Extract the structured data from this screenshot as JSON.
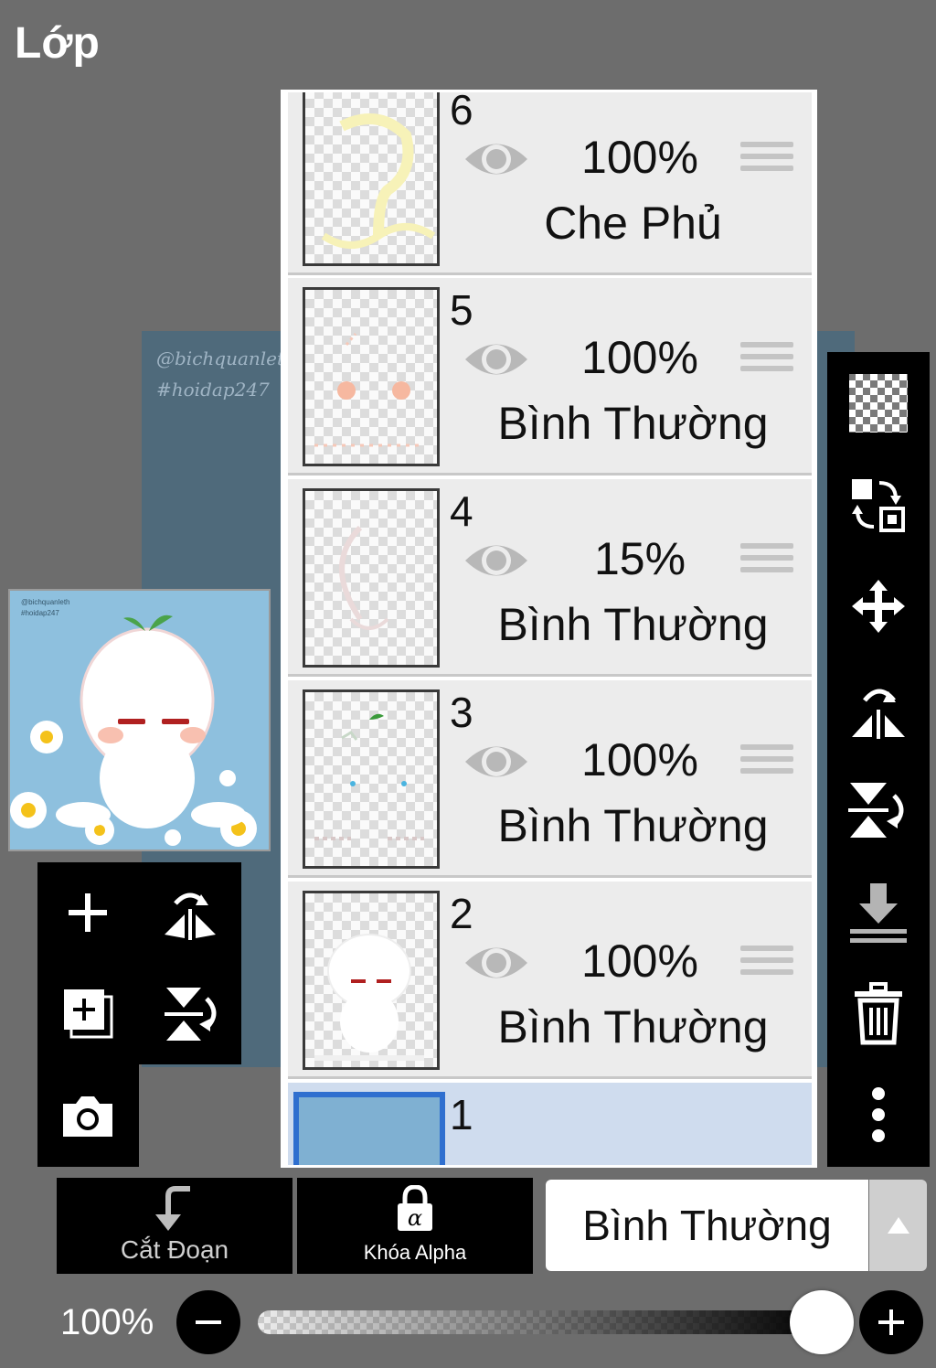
{
  "header": {
    "title": "Lớp"
  },
  "canvas": {
    "watermark_1": "@bichquanleth",
    "watermark_2": "#hoidap247"
  },
  "preview": {
    "line_1": "@bichquanleth",
    "line_2": "#hoidap247"
  },
  "layers": [
    {
      "number": "6",
      "opacity": "100%",
      "blend": "Che Phủ"
    },
    {
      "number": "5",
      "opacity": "100%",
      "blend": "Bình Thường"
    },
    {
      "number": "4",
      "opacity": "15%",
      "blend": "Bình Thường"
    },
    {
      "number": "3",
      "opacity": "100%",
      "blend": "Bình Thường"
    },
    {
      "number": "2",
      "opacity": "100%",
      "blend": "Bình Thường"
    },
    {
      "number": "1",
      "opacity": "",
      "blend": ""
    }
  ],
  "selected_layer": "1",
  "left_tools": [
    "add-layer-icon",
    "flip-horizontal-icon",
    "duplicate-layer-icon",
    "flip-vertical-icon",
    "camera-icon"
  ],
  "right_tools": [
    "transparency-icon",
    "swap-layer-icon",
    "move-icon",
    "flip-horizontal-icon",
    "flip-vertical-icon",
    "merge-down-icon",
    "trash-icon",
    "more-icon"
  ],
  "bottom": {
    "clip_label": "Cắt Đoạn",
    "alpha_lock_label": "Khóa Alpha",
    "blend_mode": "Bình Thường"
  },
  "opacity_slider": {
    "label": "100%",
    "value": 1.0
  },
  "colors": {
    "background": "#6d6d6d",
    "toolbar": "#000000",
    "selected_row": "#cfdcee",
    "selected_border": "#2f6fcf",
    "row": "#ececec"
  }
}
